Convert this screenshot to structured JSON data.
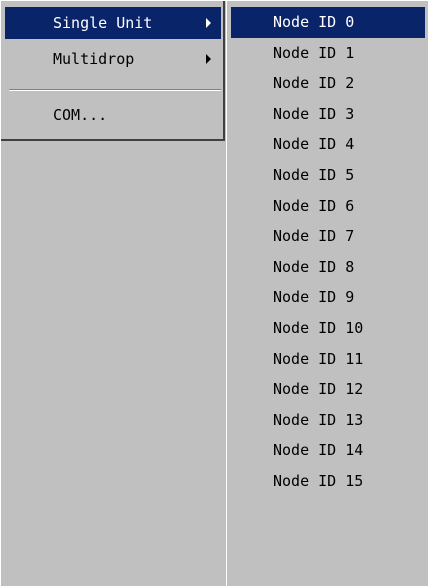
{
  "main_menu": {
    "items": [
      {
        "label": "Single Unit",
        "has_submenu": true,
        "selected": true
      },
      {
        "label": "Multidrop",
        "has_submenu": true,
        "selected": false
      },
      {
        "label": "COM...",
        "has_submenu": false,
        "selected": false
      }
    ]
  },
  "submenu": {
    "items": [
      {
        "label": "Node ID 0",
        "selected": true
      },
      {
        "label": "Node ID 1"
      },
      {
        "label": "Node ID 2"
      },
      {
        "label": "Node ID 3"
      },
      {
        "label": "Node ID 4"
      },
      {
        "label": "Node ID 5"
      },
      {
        "label": "Node ID 6"
      },
      {
        "label": "Node ID 7"
      },
      {
        "label": "Node ID 8"
      },
      {
        "label": "Node ID 9"
      },
      {
        "label": "Node ID 10"
      },
      {
        "label": "Node ID 11"
      },
      {
        "label": "Node ID 12"
      },
      {
        "label": "Node ID 13"
      },
      {
        "label": "Node ID 14"
      },
      {
        "label": "Node ID 15"
      }
    ]
  },
  "colors": {
    "menu_background": "#c0c0c0",
    "highlight": "#0a246a",
    "highlight_text": "#ffffff"
  }
}
